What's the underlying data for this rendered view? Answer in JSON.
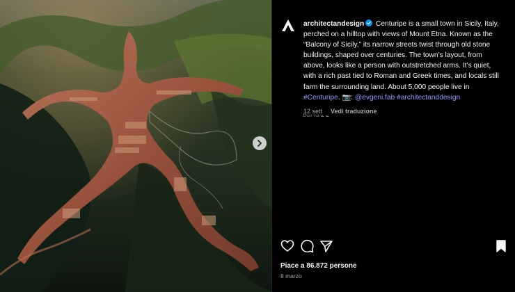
{
  "post": {
    "username": "architectandesign",
    "caption_main": " Centuripe is a small town in Sicily, Italy, perched on a hilltop with views of Mount Etna. Known as the “Balcony of Sicily,” its narrow streets twist through old stone buildings, shaped over centuries. The town’s layout, from above, looks like a person with outstretched arms. It’s quiet, with a rich past tied to Roman and Greek times, and locals still farm the surrounding land. About 5,000 people live in ",
    "hashtag_town": "#Centuripe",
    "caption_after_tag": ". 📷: ",
    "mention": "@evgeni.fab",
    "hashtag_brand": "#architectanddesign",
    "timestamp": "12 sett",
    "translate_label": "Vedi traduzione",
    "cut_text": "Per te ▸ ▸",
    "likes": "Piace a 86.872 persone",
    "date": "8 marzo"
  },
  "icons": {
    "logo": "brand-logo-icon",
    "verified": "verified-badge-icon",
    "next": "chevron-right-icon",
    "like": "heart-icon",
    "comment": "comment-icon",
    "share": "send-icon",
    "save": "bookmark-icon"
  },
  "colors": {
    "background": "#000000",
    "text": "#f5f5f5",
    "muted": "#a8a8a8",
    "link": "#8c9bff",
    "verified": "#0095f6"
  }
}
